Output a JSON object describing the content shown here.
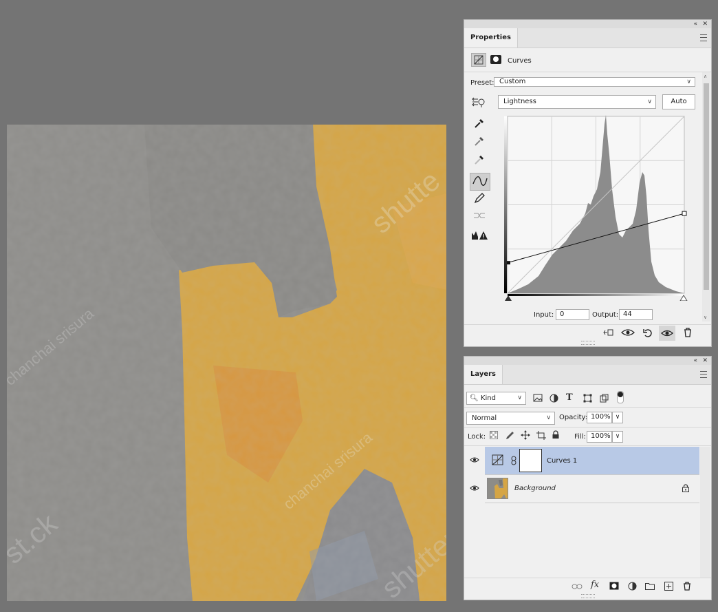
{
  "properties": {
    "tab": "Properties",
    "adjustment_label": "Curves",
    "preset_label": "Preset:",
    "preset_value": "Custom",
    "channel_value": "Lightness",
    "auto_label": "Auto",
    "input_label": "Input:",
    "input_value": "0",
    "output_label": "Output:",
    "output_value": "44",
    "curve_points": [
      [
        0,
        44
      ],
      [
        255,
        115
      ]
    ]
  },
  "layers": {
    "tab": "Layers",
    "filter_kind": "Kind",
    "blend_mode": "Normal",
    "opacity_label": "Opacity:",
    "opacity_value": "100%",
    "lock_label": "Lock:",
    "fill_label": "Fill:",
    "fill_value": "100%",
    "items": [
      {
        "name": "Curves 1",
        "selected": true,
        "visible": true
      },
      {
        "name": "Background",
        "selected": false,
        "visible": true,
        "locked": true
      }
    ]
  },
  "canvas": {
    "watermarks": [
      "shutte",
      "chanchai srisura",
      "chanchai srisura",
      "st.ck",
      "shutter"
    ]
  },
  "colors": {
    "workspace": "#747474",
    "panel": "#f0f0f0",
    "selected_layer": "#b8c9e6",
    "map_yellow": "#dba93c"
  }
}
